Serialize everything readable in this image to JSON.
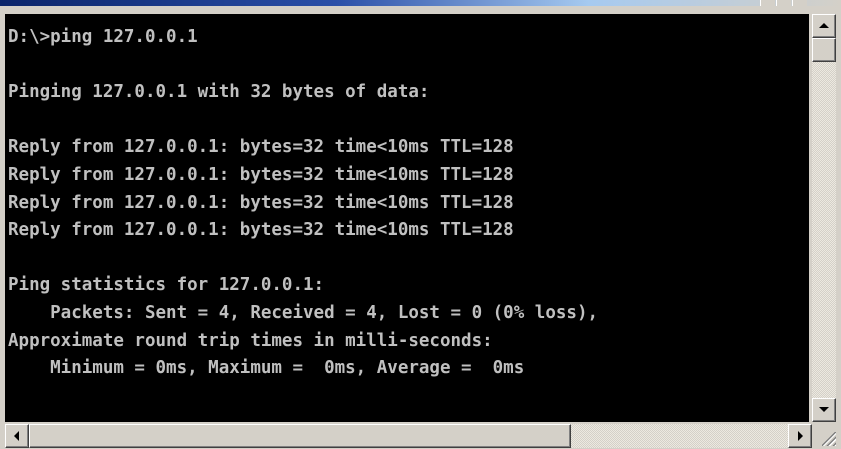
{
  "console": {
    "background": "#000000",
    "text_color": "#c0c0c0",
    "lines": [
      "D:\\>ping 127.0.0.1",
      "",
      "Pinging 127.0.0.1 with 32 bytes of data:",
      "",
      "Reply from 127.0.0.1: bytes=32 time<10ms TTL=128",
      "Reply from 127.0.0.1: bytes=32 time<10ms TTL=128",
      "Reply from 127.0.0.1: bytes=32 time<10ms TTL=128",
      "Reply from 127.0.0.1: bytes=32 time<10ms TTL=128",
      "",
      "Ping statistics for 127.0.0.1:",
      "    Packets: Sent = 4, Received = 4, Lost = 0 (0% loss),",
      "Approximate round trip times in milli-seconds:",
      "    Minimum = 0ms, Maximum =  0ms, Average =  0ms"
    ]
  },
  "scrollbars": {
    "vertical": {
      "up_icon": "arrow-up-icon",
      "down_icon": "arrow-down-icon",
      "position": 0.0
    },
    "horizontal": {
      "left_icon": "arrow-left-icon",
      "right_icon": "arrow-right-icon",
      "position": 0.0
    }
  }
}
